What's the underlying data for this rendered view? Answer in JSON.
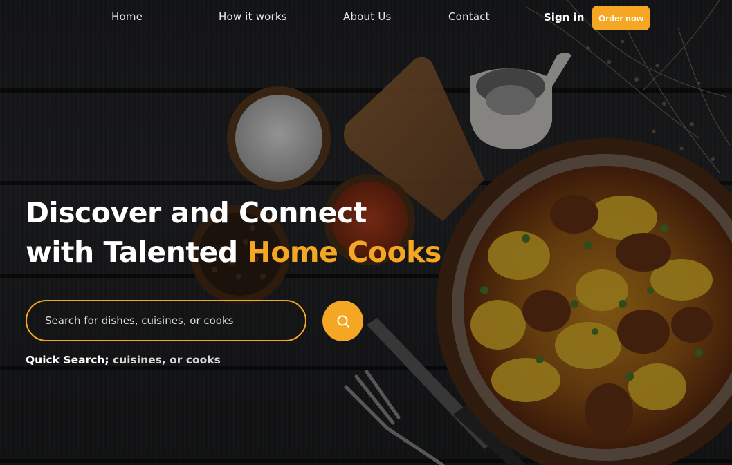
{
  "nav": {
    "links": [
      "Home",
      "How it works",
      "About Us",
      "Contact"
    ],
    "sign_in": "Sign in",
    "order_now": "Order now"
  },
  "hero": {
    "title_line1": "Discover and Connect",
    "title_line2_prefix": "with Talented ",
    "title_line2_accent": "Home Cooks"
  },
  "search": {
    "placeholder": "Search for dishes, cuisines, or cooks",
    "button_icon": "search-icon"
  },
  "quick_search": {
    "label": "Quick Search;",
    "text": " cuisines, or cooks"
  },
  "colors": {
    "accent": "#f5a623",
    "background": "#222325"
  }
}
